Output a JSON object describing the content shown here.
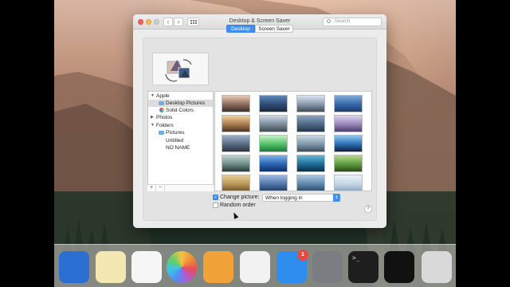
{
  "window": {
    "title": "Desktop & Screen Saver",
    "search_placeholder": "Search",
    "back_glyph": "‹",
    "forward_glyph": "›"
  },
  "tabs": [
    {
      "label": "Desktop",
      "selected": true
    },
    {
      "label": "Screen Saver",
      "selected": false
    }
  ],
  "sidebar": {
    "items": [
      {
        "label": "Apple",
        "disclosure": "▼"
      },
      {
        "label": "Desktop Pictures",
        "icon": "folder-icon",
        "selected": true
      },
      {
        "label": "Solid Colors",
        "icon": "color-wheel-icon"
      },
      {
        "label": "Photos",
        "disclosure": "▶"
      },
      {
        "label": "Folders",
        "disclosure": "▼"
      },
      {
        "label": "Pictures",
        "icon": "folder-icon"
      },
      {
        "label": "Untitled"
      },
      {
        "label": "NO NAME"
      }
    ],
    "add_label": "+",
    "remove_label": "−"
  },
  "options": {
    "change_picture_label": "Change picture:",
    "change_picture_checked": true,
    "interval_value": "When logging in",
    "random_order_label": "Random order",
    "random_order_checked": false,
    "help_label": "?"
  },
  "thumbnails": [
    {
      "colors": [
        "#e9c9b6",
        "#8c6a5a",
        "#3b2f2a"
      ]
    },
    {
      "colors": [
        "#5f87b7",
        "#2e4c73",
        "#1a2940"
      ]
    },
    {
      "colors": [
        "#d9e4f0",
        "#8897a8",
        "#3e4b5a"
      ]
    },
    {
      "colors": [
        "#7fa7d9",
        "#3568a8",
        "#1c3e6e"
      ]
    },
    {
      "colors": [
        "#f2d39b",
        "#a97a4e",
        "#4a3526"
      ]
    },
    {
      "colors": [
        "#cdd8e6",
        "#7a8a99",
        "#404b54"
      ]
    },
    {
      "colors": [
        "#8aa4c1",
        "#4d6884",
        "#25384a"
      ]
    },
    {
      "colors": [
        "#dcd2ef",
        "#9786b9",
        "#4b3f6b"
      ]
    },
    {
      "colors": [
        "#9cb1c9",
        "#56697f",
        "#2b3641"
      ]
    },
    {
      "colors": [
        "#c7f1c4",
        "#4fbf68",
        "#1f7a3a"
      ]
    },
    {
      "colors": [
        "#c8d7e2",
        "#7f98ab",
        "#3c4f5e"
      ]
    },
    {
      "colors": [
        "#8fc8ef",
        "#2a6db3",
        "#0e1f3d"
      ]
    },
    {
      "colors": [
        "#bdd3ce",
        "#6d8c86",
        "#2c3b38"
      ]
    },
    {
      "colors": [
        "#7fb3ec",
        "#2a63b0",
        "#10306a"
      ]
    },
    {
      "colors": [
        "#63b6d8",
        "#1e6b96",
        "#0b2f45"
      ]
    },
    {
      "colors": [
        "#b8d98f",
        "#5c9a3d",
        "#2a4d1c"
      ]
    },
    {
      "colors": [
        "#e6cf9a",
        "#b89656",
        "#6b5430"
      ]
    },
    {
      "colors": [
        "#9cb9e2",
        "#4e74a8",
        "#223c5e"
      ]
    },
    {
      "colors": [
        "#a9c7e0",
        "#5d87ab",
        "#2a4763"
      ]
    },
    {
      "colors": [
        "#eaf3fa",
        "#c3d5e5",
        "#8ea7bd"
      ]
    }
  ],
  "dock": {
    "items": [
      {
        "name": "xcode-icon",
        "bg": "#2a6fd1"
      },
      {
        "name": "textedit-icon",
        "bg": "#f3e7b2"
      },
      {
        "name": "reminders-icon",
        "bg": "#f6f6f6"
      },
      {
        "name": "photos-icon",
        "bg": "#ffffff"
      },
      {
        "name": "pages-icon",
        "bg": "#f1a33a"
      },
      {
        "name": "itunes-icon",
        "bg": "#f2f2f2"
      },
      {
        "name": "app-store-icon",
        "bg": "#2d8ef0"
      },
      {
        "name": "system-preferences-icon",
        "bg": "#7a7d82"
      },
      {
        "name": "terminal-icon",
        "bg": "#1e1e1e"
      },
      {
        "name": "activity-monitor-icon",
        "bg": "#111111"
      },
      {
        "name": "disk-utility-icon",
        "bg": "#d9d9d9"
      }
    ],
    "app_store_badge": "1",
    "terminal_prompt": ">_"
  },
  "colors": {
    "accent": "#3e8ff0"
  }
}
